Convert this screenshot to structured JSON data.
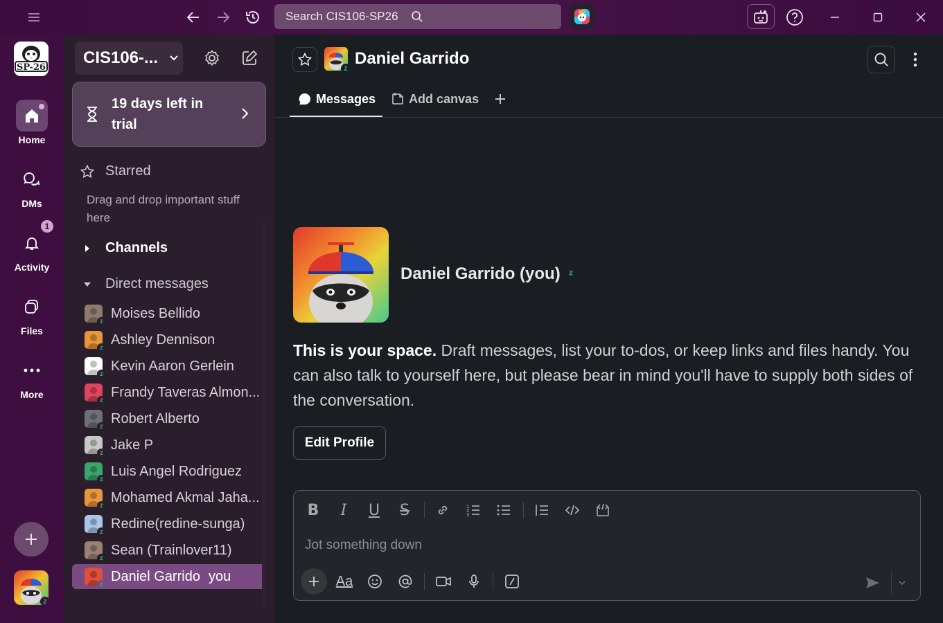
{
  "titlebar": {
    "search_placeholder": "Search CIS106-SP26",
    "icons": [
      "hamburger-icon",
      "back-arrow-icon",
      "forward-arrow-icon",
      "history-icon",
      "search-icon",
      "app-icon",
      "assistant-icon",
      "help-icon",
      "minimize-icon",
      "maximize-icon",
      "close-icon"
    ]
  },
  "rail": {
    "workspace_badge": "SP-26",
    "items": [
      {
        "label": "Home",
        "icon": "home-icon",
        "active": true
      },
      {
        "label": "DMs",
        "icon": "dms-icon"
      },
      {
        "label": "Activity",
        "icon": "bell-icon",
        "badge": "1"
      },
      {
        "label": "Files",
        "icon": "files-icon"
      },
      {
        "label": "More",
        "icon": "more-icon"
      }
    ]
  },
  "sidebar": {
    "workspace_name": "CIS106-...",
    "trial_text": "19 days left in trial",
    "starred_label": "Starred",
    "drag_hint": "Drag and drop important stuff here",
    "channels_label": "Channels",
    "dms_label": "Direct messages",
    "dms": [
      {
        "name": "Moises Bellido",
        "color": "#8c7b6e"
      },
      {
        "name": "Ashley Dennison",
        "color": "#e8953b"
      },
      {
        "name": "Kevin Aaron Gerlein",
        "color": "#ffffff"
      },
      {
        "name": "Frandy Taveras Almon...",
        "color": "#e0435d"
      },
      {
        "name": "Robert Alberto",
        "color": "#6d7076"
      },
      {
        "name": "Jake P",
        "color": "#c8c8c8"
      },
      {
        "name": "Luis Angel Rodriguez",
        "color": "#3aa56b"
      },
      {
        "name": "Mohamed Akmal Jaha...",
        "color": "#e8953b"
      },
      {
        "name": "Redine(redine-sunga)",
        "color": "#a9c5e8"
      },
      {
        "name": "Sean (Trainlover11)",
        "color": "#9a8174"
      },
      {
        "name": "Daniel Garrido",
        "you": "you",
        "color": "#e34d3b",
        "active": true
      }
    ]
  },
  "channel": {
    "title": "Daniel Garrido",
    "tabs": [
      {
        "label": "Messages",
        "icon": "message-icon",
        "active": true
      },
      {
        "label": "Add canvas",
        "icon": "canvas-icon"
      }
    ],
    "profile_name": "Daniel Garrido (you)",
    "intro_bold": "This is your space.",
    "intro_text": " Draft messages, list your to-dos, or keep links and files handy. You can also talk to yourself here, but please bear in mind you'll have to supply both sides of the conversation.",
    "edit_profile": "Edit Profile"
  },
  "composer": {
    "placeholder": "Jot something down",
    "format_icons": [
      "bold-icon",
      "italic-icon",
      "underline-icon",
      "strikethrough-icon",
      "link-icon",
      "ordered-list-icon",
      "bulleted-list-icon",
      "blockquote-icon",
      "code-icon",
      "code-block-icon"
    ],
    "action_icons": [
      "plus-icon",
      "text-format-icon",
      "emoji-icon",
      "mention-icon",
      "video-icon",
      "microphone-icon",
      "slash-command-icon",
      "send-icon",
      "chevron-down-icon"
    ]
  },
  "colors": {
    "aubergine": "#3f0e40",
    "sidebar": "#2a1d2c",
    "main": "#1a1d21",
    "active_dm": "#7a4b82",
    "presence": "#2bac76"
  }
}
